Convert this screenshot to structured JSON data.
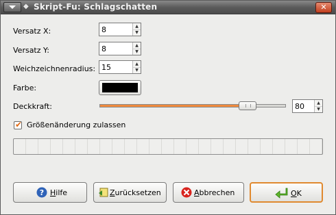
{
  "window": {
    "title": "Skript-Fu: Schlagschatten",
    "close_glyph": "✕"
  },
  "fields": {
    "offset_x": {
      "label": "Versatz X:",
      "value": "8"
    },
    "offset_y": {
      "label": "Versatz Y:",
      "value": "8"
    },
    "blur_radius": {
      "label": "Weichzeichnenradius:",
      "value": "15"
    },
    "color": {
      "label": "Farbe:",
      "value": "#000000"
    },
    "opacity": {
      "label": "Deckkraft:",
      "value": "80",
      "fraction": 0.8
    },
    "resize": {
      "label": "Größenänderung zulassen",
      "checked": true
    }
  },
  "buttons": {
    "help": {
      "mnemonic": "H",
      "rest": "ilfe"
    },
    "reset": {
      "mnemonic": "Z",
      "rest": "urücksetzen"
    },
    "cancel": {
      "mnemonic": "A",
      "rest": "bbrechen"
    },
    "ok": {
      "mnemonic": "O",
      "rest": "K"
    }
  },
  "colors": {
    "accent": "#f08a3d",
    "titlebar": "#5c5c5c",
    "dialog_bg": "#ededeb"
  }
}
